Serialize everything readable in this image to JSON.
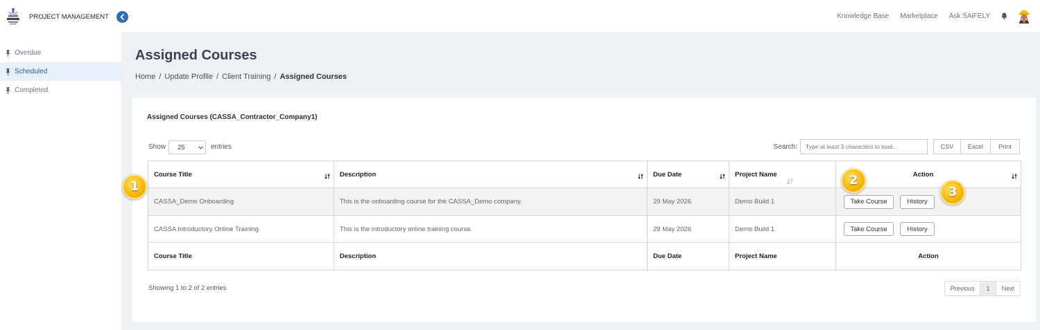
{
  "colors": {
    "accent": "#2f6db5",
    "sidebar_active_bg": "#e8f0fa",
    "sidebar_active_text": "#2a5ca5",
    "annotation": "#f7b500",
    "page_bg": "#eef1f5"
  },
  "header": {
    "logo_icon": "company-logo-icon",
    "app_title": "PROJECT MANAGEMENT",
    "collapse_icon": "chevron-left-icon",
    "links": [
      "Knowledge Base",
      "Marketplace",
      "Ask SAiFELY"
    ],
    "notification_icon": "bell-icon",
    "avatar_icon": "user-hardhat-icon"
  },
  "sidebar": {
    "items": [
      {
        "label": "Overdue",
        "icon": "pin-icon",
        "active": false
      },
      {
        "label": "Scheduled",
        "icon": "pin-icon",
        "active": true
      },
      {
        "label": "Completed",
        "icon": "pin-icon",
        "active": false
      }
    ]
  },
  "page": {
    "title": "Assigned Courses",
    "breadcrumb": [
      "Home",
      "Update Profile",
      "Client Training",
      "Assigned Courses"
    ],
    "breadcrumb_separator": "/"
  },
  "card": {
    "title": "Assigned Courses (CASSA_Contractor_Company1)",
    "length_menu": {
      "show_label": "Show",
      "selected": "25",
      "entries_label": "entries"
    },
    "search": {
      "label": "Search:",
      "placeholder": "Type at least 3 characters to load..."
    },
    "export_buttons": [
      "CSV",
      "Excel",
      "Print"
    ]
  },
  "table": {
    "columns": [
      {
        "label": "Course Title",
        "sort_icon": "sort-both-icon"
      },
      {
        "label": "Description",
        "sort_icon": "sort-both-icon"
      },
      {
        "label": "Due Date",
        "sort_icon": "sort-both-icon"
      },
      {
        "label": "Project Name",
        "sort_icon": "sort-asc-icon"
      },
      {
        "label": "Action",
        "sort_icon": "sort-both-icon"
      }
    ],
    "rows": [
      {
        "course_title": "CASSA_Demo Onboarding",
        "description": "This is the onboarding course for the CASSA_Demo company.",
        "due_date": "29 May 2026",
        "project_name": "Demo Build 1",
        "actions": [
          "Take Course",
          "History"
        ]
      },
      {
        "course_title": "CASSA Introductory Online Training",
        "description": "This is the introductory online training course.",
        "due_date": "29 May 2026",
        "project_name": "Demo Build 1",
        "actions": [
          "Take Course",
          "History"
        ]
      }
    ],
    "footer": [
      "Course Title",
      "Description",
      "Due Date",
      "Project Name",
      "Action"
    ],
    "info": "Showing 1 to 2 of 2 entries",
    "pagination": {
      "previous": "Previous",
      "pages": [
        {
          "label": "1",
          "active": true
        }
      ],
      "next": "Next"
    }
  },
  "annotations": [
    "1",
    "2",
    "3"
  ]
}
